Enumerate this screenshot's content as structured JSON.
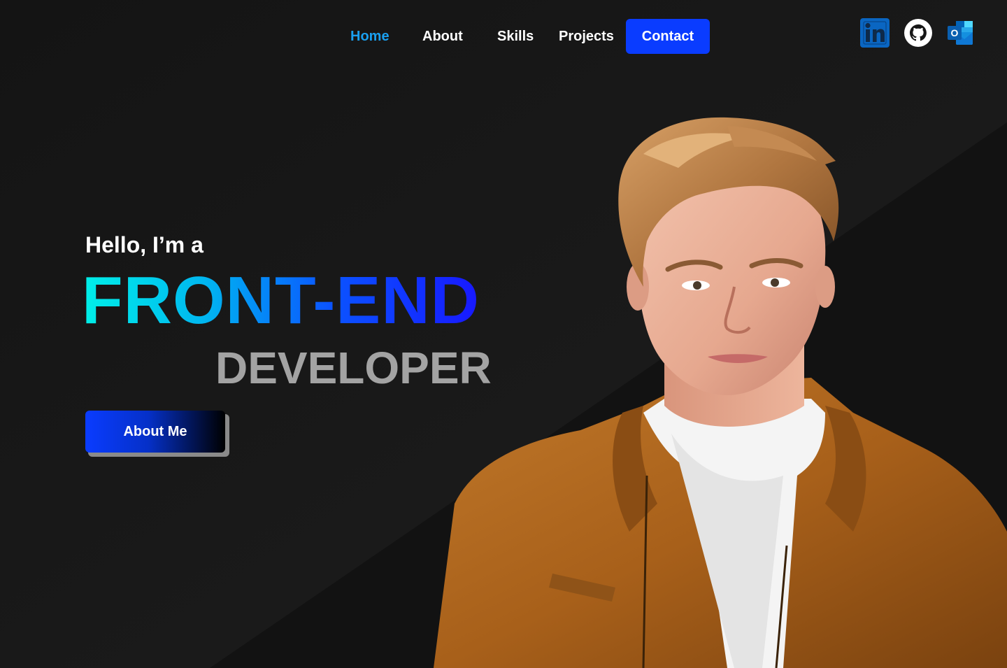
{
  "nav": {
    "home": "Home",
    "about": "About",
    "skills": "Skills",
    "projects": "Projects",
    "contact": "Contact",
    "active": "Home"
  },
  "social": [
    {
      "name": "linkedin-icon",
      "glyph": "in"
    },
    {
      "name": "github-icon"
    },
    {
      "name": "outlook-icon",
      "glyph": "O"
    }
  ],
  "hero": {
    "greeting": "Hello, I’m a",
    "role": "FRONT-END",
    "title": "DEVELOPER",
    "cta_label": "About Me"
  },
  "colors": {
    "accent": "#0a3cff",
    "active_link": "#1aa0f0",
    "gradient_start": "#00f0e8",
    "gradient_end": "#1818ff",
    "muted": "#a3a3a3",
    "linkedin": "#0a66c2",
    "outlook": "#0f78d4"
  }
}
